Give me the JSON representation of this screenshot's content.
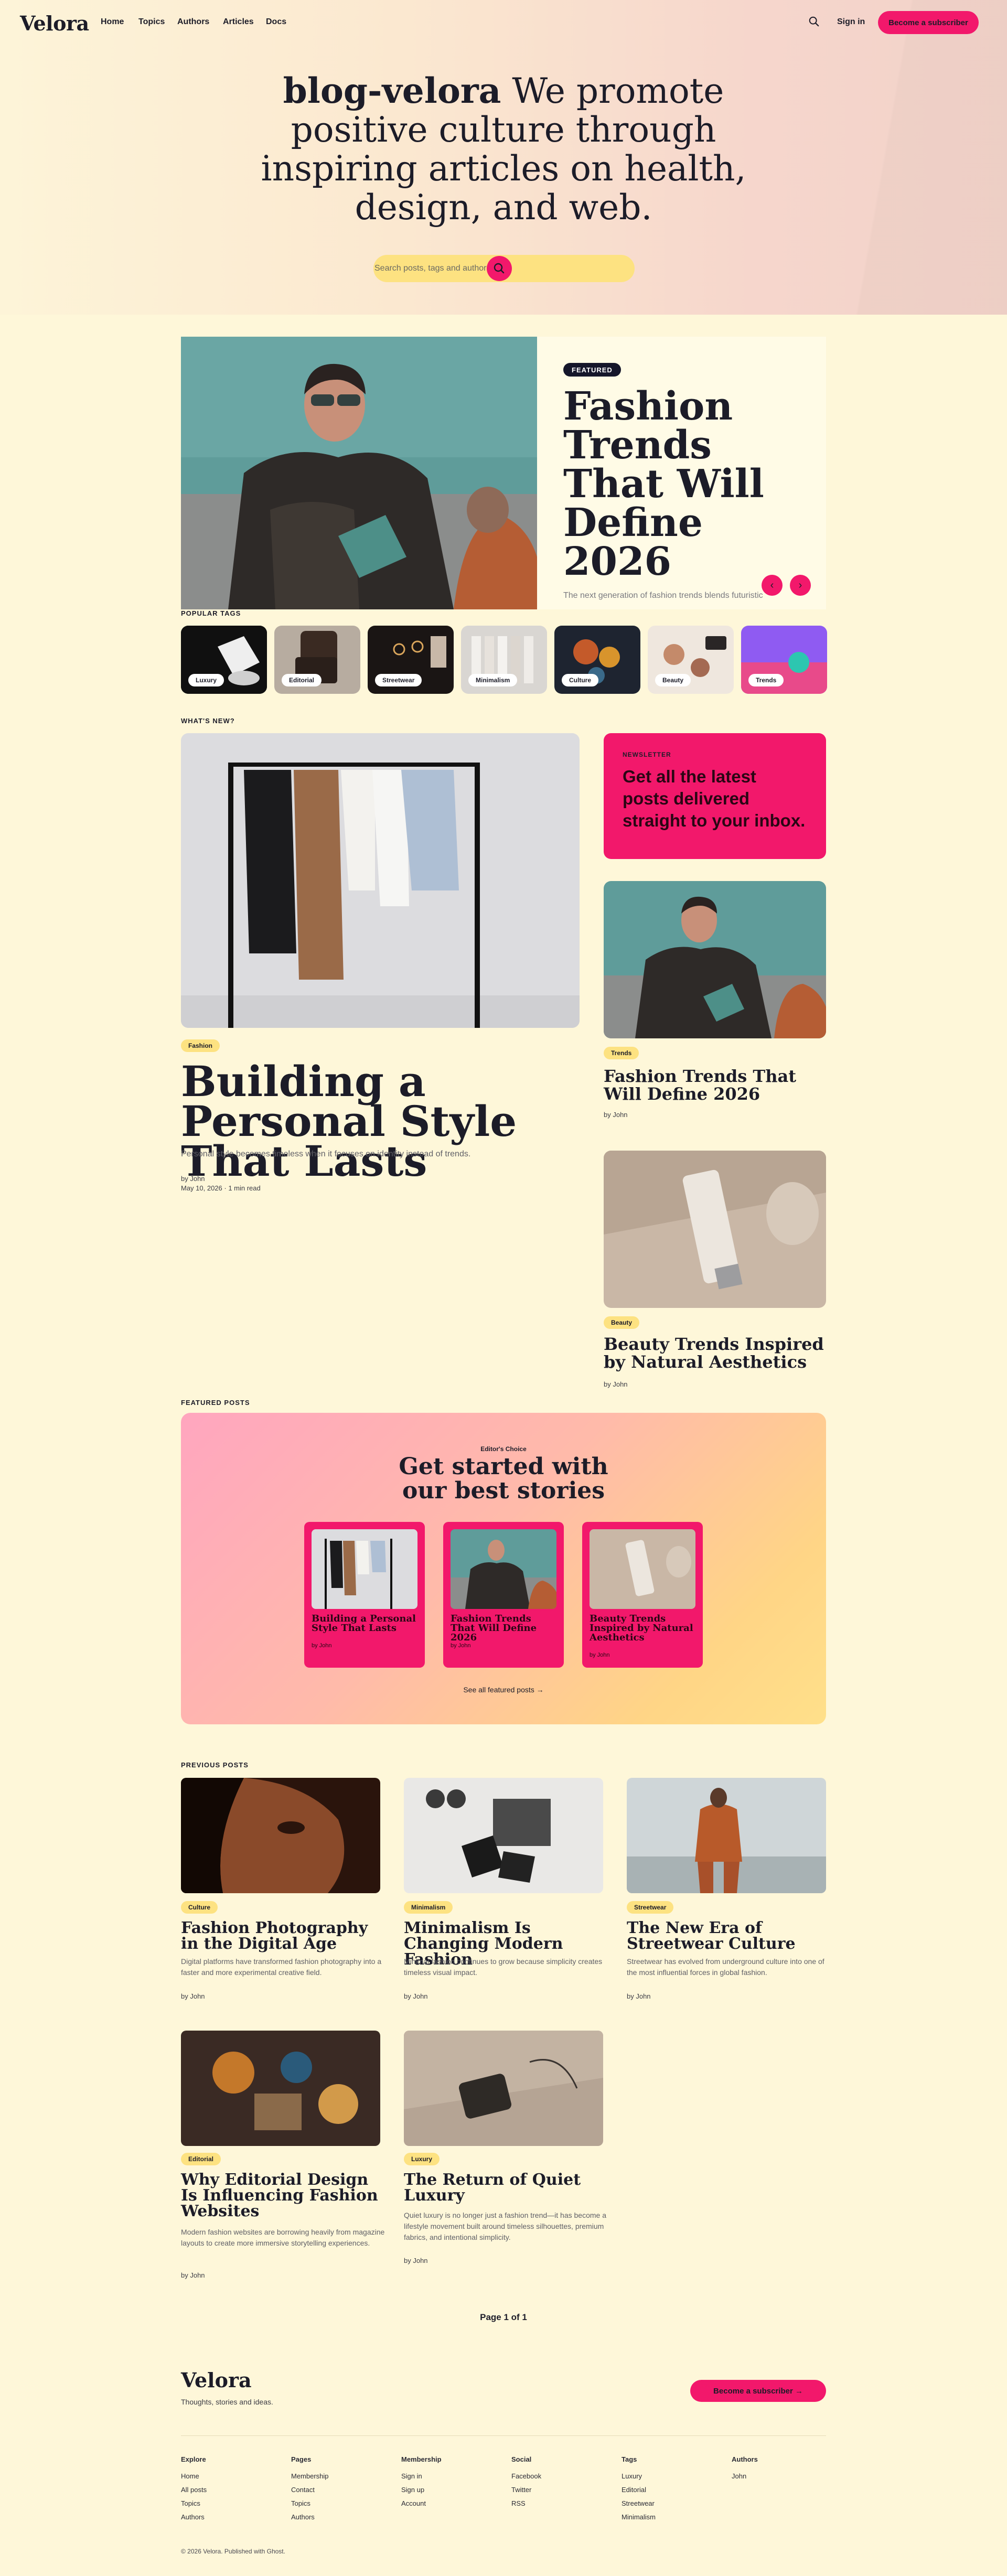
{
  "site": {
    "logo": "Velora",
    "tagline": "Thoughts, stories and ideas."
  },
  "nav": {
    "items": [
      "Home",
      "Topics",
      "Authors",
      "Articles",
      "Docs"
    ],
    "signin": "Sign in",
    "subscribe": "Become a subscriber"
  },
  "hero": {
    "brand": "blog-velora",
    "headline": "We promote positive culture through inspiring articles on health, design, and web.",
    "search_placeholder": "Search posts, tags and authors"
  },
  "featured": {
    "badge": "FEATURED",
    "title": "Fashion Trends That Will Define 2026",
    "excerpt": "The next generation of fashion trends blends futuristic"
  },
  "popular_tags": {
    "label": "POPULAR TAGS",
    "tags": [
      "Luxury",
      "Editorial",
      "Streetwear",
      "Minimalism",
      "Culture",
      "Beauty",
      "Trends"
    ]
  },
  "whats_new": {
    "label": "WHAT'S NEW?",
    "main": {
      "tag": "Fashion",
      "title": "Building a Personal Style That Lasts",
      "excerpt": "Personal style becomes timeless when it focuses on identity instead of trends.",
      "author": "by John",
      "date": "May 10, 2026 · 1 min read"
    },
    "newsletter": {
      "label": "NEWSLETTER",
      "text": "Get all the latest posts delivered straight to your inbox."
    },
    "side": [
      {
        "tag": "Trends",
        "title": "Fashion Trends That Will Define 2026",
        "author": "by John"
      },
      {
        "tag": "Beauty",
        "title": "Beauty Trends Inspired by Natural Aesthetics",
        "author": "by John"
      }
    ]
  },
  "featured_posts": {
    "label": "FEATURED POSTS",
    "kicker": "Editor's Choice",
    "title": "Get started with our best stories",
    "cards": [
      {
        "title": "Building a Personal Style That Lasts",
        "author": "by John"
      },
      {
        "title": "Fashion Trends That Will Define 2026",
        "author": "by John"
      },
      {
        "title": "Beauty Trends Inspired by Natural Aesthetics",
        "author": "by John"
      }
    ],
    "see_all": "See all featured posts →"
  },
  "previous_posts": {
    "label": "PREVIOUS POSTS",
    "posts": [
      {
        "tag": "Culture",
        "title": "Fashion Photography in the Digital Age",
        "excerpt": "Digital platforms have transformed fashion photography into a faster and more experimental creative field.",
        "author": "by John"
      },
      {
        "tag": "Minimalism",
        "title": "Minimalism Is Changing Modern Fashion",
        "excerpt": "Minimal fashion continues to grow because simplicity creates timeless visual impact.",
        "author": "by John"
      },
      {
        "tag": "Streetwear",
        "title": "The New Era of Streetwear Culture",
        "excerpt": "Streetwear has evolved from underground culture into one of the most influential forces in global fashion.",
        "author": "by John"
      },
      {
        "tag": "Editorial",
        "title": "Why Editorial Design Is Influencing Fashion Websites",
        "excerpt": "Modern fashion websites are borrowing heavily from magazine layouts to create more immersive storytelling experiences.",
        "author": "by John"
      },
      {
        "tag": "Luxury",
        "title": "The Return of Quiet Luxury",
        "excerpt": "Quiet luxury is no longer just a fashion trend—it has become a lifestyle movement built around timeless silhouettes, premium fabrics, and intentional simplicity.",
        "author": "by John"
      }
    ]
  },
  "pagination": "Page 1 of 1",
  "footer": {
    "subscribe": "Become a subscriber →",
    "columns": [
      {
        "heading": "Explore",
        "links": [
          "Home",
          "All posts",
          "Topics",
          "Authors"
        ]
      },
      {
        "heading": "Pages",
        "links": [
          "Membership",
          "Contact",
          "Topics",
          "Authors"
        ]
      },
      {
        "heading": "Membership",
        "links": [
          "Sign in",
          "Sign up",
          "Account"
        ]
      },
      {
        "heading": "Social",
        "links": [
          "Facebook",
          "Twitter",
          "RSS"
        ]
      },
      {
        "heading": "Tags",
        "links": [
          "Luxury",
          "Editorial",
          "Streetwear",
          "Minimalism"
        ]
      },
      {
        "heading": "Authors",
        "links": [
          "John"
        ]
      }
    ],
    "copyright": "© 2026 Velora. Published with Ghost."
  },
  "colors": {
    "background": "#fef7d9",
    "accent": "#f2186b",
    "pill_yellow": "#fde281",
    "text": "#1c1c28"
  }
}
